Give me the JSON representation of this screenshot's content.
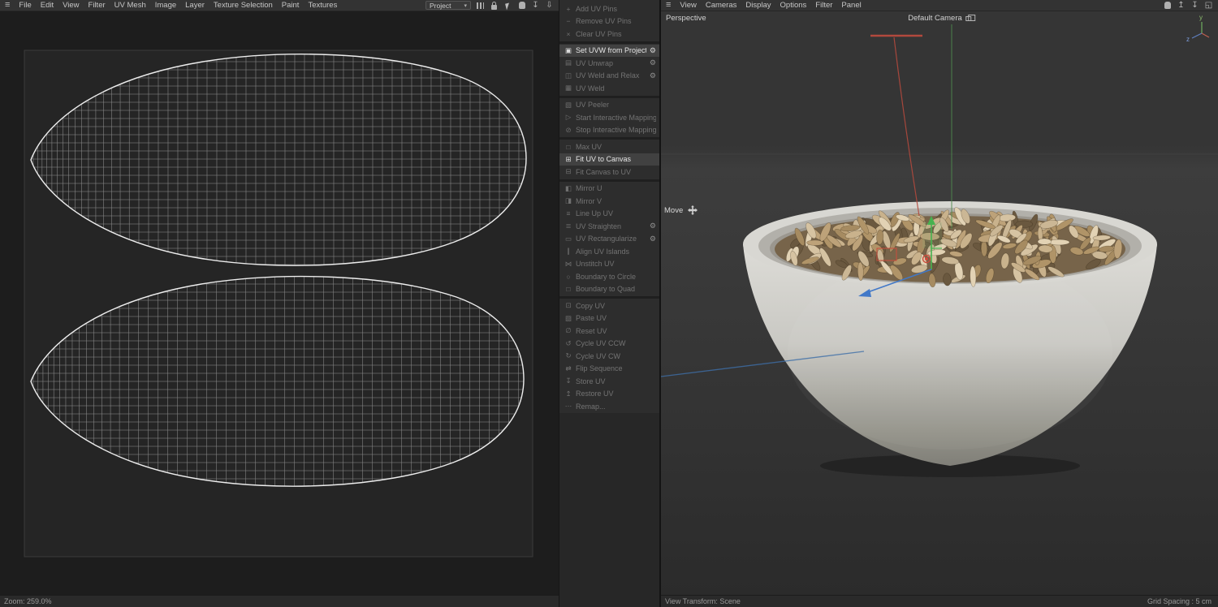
{
  "uv_editor": {
    "menu_items": [
      "File",
      "Edit",
      "View",
      "Filter",
      "UV Mesh",
      "Image",
      "Layer",
      "Texture Selection",
      "Paint",
      "Textures"
    ],
    "project_selector": {
      "value": "Project"
    },
    "status": {
      "zoom": "Zoom: 259.0%"
    }
  },
  "tool_panel": {
    "items": [
      {
        "label": "Add UV Pins",
        "glyph": "+",
        "state": "disabled"
      },
      {
        "label": "Remove UV Pins",
        "glyph": "−",
        "state": "disabled"
      },
      {
        "label": "Clear UV Pins",
        "glyph": "×",
        "state": "disabled"
      },
      {
        "label": "Set UVW from Projection",
        "glyph": "▣",
        "gear": true,
        "state": "active",
        "sep": true
      },
      {
        "label": "UV Unwrap",
        "glyph": "▤",
        "gear": true,
        "state": "disabled"
      },
      {
        "label": "UV Weld and Relax",
        "glyph": "◫",
        "gear": true,
        "state": "disabled"
      },
      {
        "label": "UV Weld",
        "glyph": "▦",
        "state": "disabled"
      },
      {
        "label": "UV Peeler",
        "glyph": "▧",
        "state": "disabled",
        "sep": true
      },
      {
        "label": "Start Interactive Mapping",
        "glyph": "▷",
        "state": "disabled"
      },
      {
        "label": "Stop Interactive Mapping",
        "glyph": "⊘",
        "state": "disabled"
      },
      {
        "label": "Max UV",
        "glyph": "□",
        "state": "disabled",
        "sep": true
      },
      {
        "label": "Fit UV to Canvas",
        "glyph": "⊞",
        "state": "active"
      },
      {
        "label": "Fit Canvas to UV",
        "glyph": "⊟",
        "state": "disabled"
      },
      {
        "label": "Mirror U",
        "glyph": "◧",
        "state": "disabled",
        "sep": true
      },
      {
        "label": "Mirror V",
        "glyph": "◨",
        "state": "disabled"
      },
      {
        "label": "Line Up UV",
        "glyph": "≡",
        "state": "disabled"
      },
      {
        "label": "UV Straighten",
        "glyph": "≣",
        "gear": true,
        "state": "disabled"
      },
      {
        "label": "UV Rectangularize",
        "glyph": "▭",
        "gear": true,
        "state": "disabled"
      },
      {
        "label": "Align UV Islands",
        "glyph": "∥",
        "state": "disabled"
      },
      {
        "label": "Unstitch UV",
        "glyph": "⋈",
        "state": "disabled"
      },
      {
        "label": "Boundary to Circle",
        "glyph": "○",
        "state": "disabled"
      },
      {
        "label": "Boundary to Quad",
        "glyph": "□",
        "state": "disabled"
      },
      {
        "label": "Copy UV",
        "glyph": "⊡",
        "state": "disabled",
        "sep": true
      },
      {
        "label": "Paste UV",
        "glyph": "▨",
        "state": "disabled"
      },
      {
        "label": "Reset UV",
        "glyph": "∅",
        "state": "disabled"
      },
      {
        "label": "Cycle UV CCW",
        "glyph": "↺",
        "state": "disabled"
      },
      {
        "label": "Cycle UV CW",
        "glyph": "↻",
        "state": "disabled"
      },
      {
        "label": "Flip Sequence",
        "glyph": "⇄",
        "state": "disabled"
      },
      {
        "label": "Store UV",
        "glyph": "↧",
        "state": "disabled"
      },
      {
        "label": "Restore UV",
        "glyph": "↥",
        "state": "disabled"
      },
      {
        "label": "Remap...",
        "glyph": "⋯",
        "state": "disabled"
      }
    ]
  },
  "viewport": {
    "menu_items": [
      "View",
      "Cameras",
      "Display",
      "Options",
      "Filter",
      "Panel"
    ],
    "view_label": "Perspective",
    "camera_label": "Default Camera",
    "tool_label": "Move",
    "axis_labels": {
      "y": "y",
      "z": "z"
    },
    "status": {
      "left": "View Transform: Scene",
      "right": "Grid Spacing : 5 cm"
    }
  },
  "colors": {
    "seed_palette": [
      "#d6c3a2",
      "#c9b28c",
      "#bda279",
      "#b09468",
      "#a68b61",
      "#e2d2b4",
      "#cbb795"
    ],
    "seed_dark": "#6a583f",
    "axis_green": "#46b24f",
    "axis_red": "#cc4b3c",
    "axis_blue": "#4178c8"
  }
}
